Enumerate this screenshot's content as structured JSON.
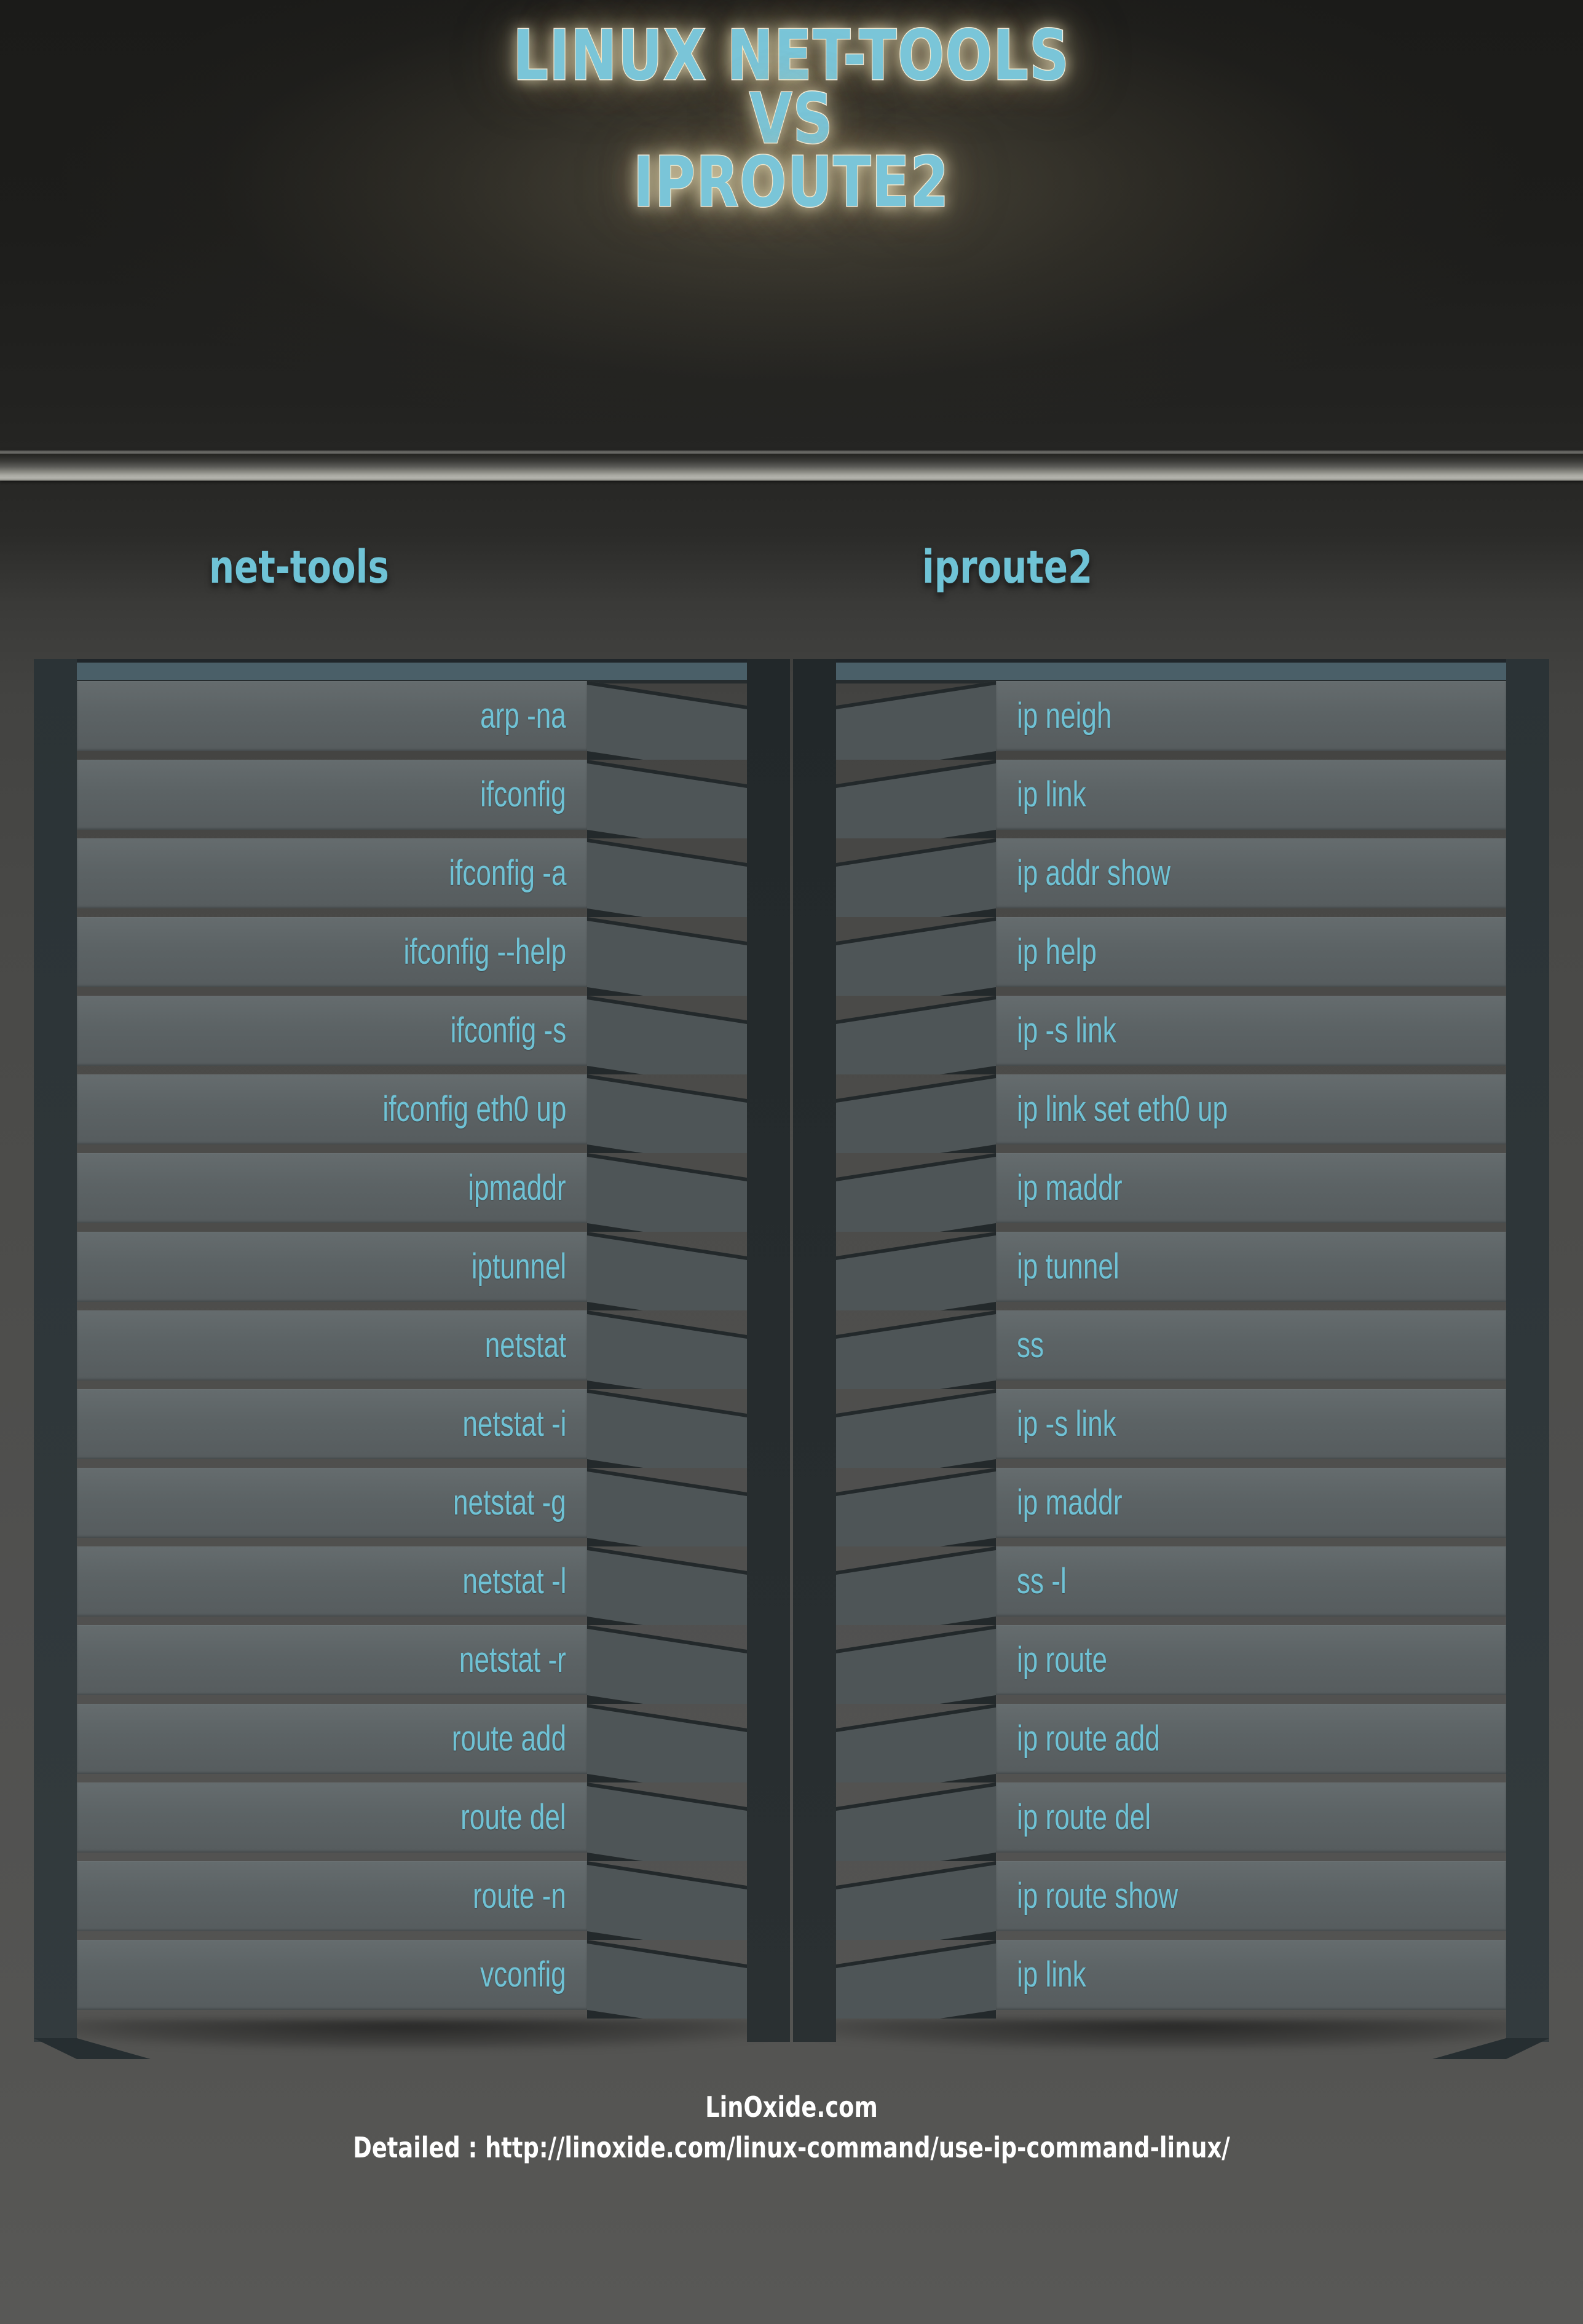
{
  "title": {
    "line1": "LINUX NET-TOOLS",
    "line2": "VS",
    "line3": "IPROUTE2"
  },
  "colors": {
    "accent_text": "#6fc2d5",
    "title_text": "#7ac5d8",
    "title_outline": "#ffffff",
    "title_glow": "#e8d9a8",
    "row_face": "#5c6365",
    "stack_cap": "#4a5f68",
    "side_wall": "#2e3639",
    "footer_text": "#ffffff",
    "background_top": "#1b1b19",
    "background_bottom": "#585856"
  },
  "columns": {
    "left": {
      "header": "net-tools",
      "rows": [
        "arp -na",
        "ifconfig",
        "ifconfig -a",
        "ifconfig --help",
        "ifconfig -s",
        "ifconfig eth0 up",
        "ipmaddr",
        "iptunnel",
        "netstat",
        "netstat -i",
        "netstat  -g",
        "netstat -l",
        "netstat -r",
        "route add",
        "route del",
        "route -n",
        "vconfig"
      ]
    },
    "right": {
      "header": "iproute2",
      "rows": [
        "ip neigh",
        "ip link",
        "ip addr show",
        "ip help",
        "ip -s link",
        "ip link set eth0 up",
        "ip maddr",
        "ip tunnel",
        "ss",
        "ip -s link",
        "ip maddr",
        "ss -l",
        "ip route",
        "ip route add",
        "ip route del",
        "ip route show",
        "ip link"
      ]
    }
  },
  "footer": {
    "site": "LinOxide.com",
    "url": "Detailed : http://linoxide.com/linux-command/use-ip-command-linux/"
  }
}
